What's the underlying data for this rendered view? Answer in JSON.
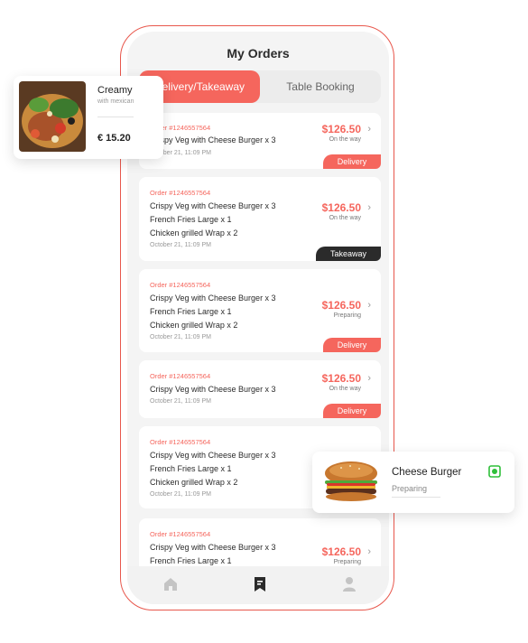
{
  "screen": {
    "title": "My Orders"
  },
  "tabs": [
    {
      "label": "Delivery/Takeaway",
      "active": true
    },
    {
      "label": "Table Booking",
      "active": false
    }
  ],
  "orders": [
    {
      "order_no": "Order #1246557564",
      "items": [
        "Crispy Veg with Cheese Burger x 3"
      ],
      "date": "October 21, 11:09 PM",
      "price": "$126.50",
      "status": "On the way",
      "badge": "Delivery"
    },
    {
      "order_no": "Order #1246557564",
      "items": [
        "Crispy Veg with Cheese Burger x 3",
        "French Fries Large x 1",
        "Chicken grilled Wrap x 2"
      ],
      "date": "October 21, 11:09 PM",
      "price": "$126.50",
      "status": "On the way",
      "badge": "Takeaway"
    },
    {
      "order_no": "Order #1246557564",
      "items": [
        "Crispy Veg with Cheese Burger x 3",
        "French Fries Large x 1",
        "Chicken grilled Wrap x 2"
      ],
      "date": "October 21, 11:09 PM",
      "price": "$126.50",
      "status": "Preparing",
      "badge": "Delivery"
    },
    {
      "order_no": "Order #1246557564",
      "items": [
        "Crispy Veg with Cheese Burger x 3"
      ],
      "date": "October 21, 11:09 PM",
      "price": "$126.50",
      "status": "On the way",
      "badge": "Delivery"
    },
    {
      "order_no": "Order #1246557564",
      "items": [
        "Crispy Veg with Cheese Burger x 3",
        "French Fries Large x 1",
        "Chicken grilled Wrap x 2"
      ],
      "date": "October 21, 11:09 PM"
    },
    {
      "order_no": "Order #1246557564",
      "items": [
        "Crispy Veg with Cheese Burger x 3",
        "French Fries Large x 1"
      ],
      "price": "$126.50",
      "status": "Preparing"
    }
  ],
  "bottom_nav": [
    {
      "icon": "home-icon",
      "active": false
    },
    {
      "icon": "receipt-icon",
      "active": true
    },
    {
      "icon": "profile-icon",
      "active": false
    }
  ],
  "float_dish": {
    "name": "Creamy",
    "subtitle": "with mexican",
    "price": "€ 15.20"
  },
  "float_burger": {
    "name": "Cheese Burger",
    "status": "Preparing"
  },
  "colors": {
    "accent": "#f5665d",
    "dark": "#2b2b2b",
    "veg_green": "#2fbf3a"
  }
}
